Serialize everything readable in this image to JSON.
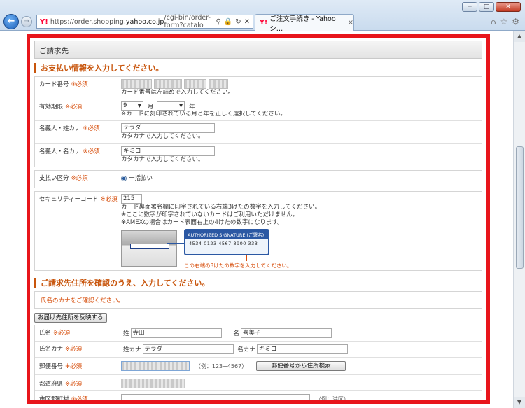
{
  "browser": {
    "url_prefix": "https://order.shopping.",
    "url_domain": "yahoo.co.jp",
    "url_suffix": "/cgi-bin/order-form?catalo",
    "tab_title": "ご注文手続き - Yahoo!シ…",
    "tab_close": "×",
    "back_icon": "back-arrow-icon",
    "forward_icon": "forward-arrow-icon",
    "win_minimize": "─",
    "win_maximize": "□",
    "win_close": "✕"
  },
  "page": {
    "header": "ご請求先",
    "payment_section": "お支払い情報を入力してください。",
    "required": "※必須",
    "card_number": {
      "label": "カード番号",
      "note": "カード番号は左詰めで入力してください。"
    },
    "expiry": {
      "label": "有効期限",
      "month_value": "9",
      "month_unit": "月",
      "year_unit": "年",
      "note": "※カードに刻印されている月と年を正しく選択してください。"
    },
    "holder_last": {
      "label": "名義人・姓カナ",
      "value": "テラダ",
      "note": "カタカナで入力してください。"
    },
    "holder_first": {
      "label": "名義人・名カナ",
      "value": "キミコ",
      "note": "カタカナで入力してください。"
    },
    "payment_type": {
      "label": "支払い区分",
      "option": "一括払い"
    },
    "security": {
      "label": "セキュリティーコード",
      "value": "215",
      "note1": "カード裏面署名欄に印字されている右端3けたの数字を入力してください。",
      "note2": "※ここに数字が印字されていないカードはご利用いただけません。",
      "note3": "※AMEXの場合はカード表面右上の4けたの数字になります。",
      "sig_caption": "AUTHORIZED SIGNATURE (ご署名)",
      "sig_number": "4534 0123 4567 8900 333",
      "img_note": "この右端の3けたの数字を入力してください。"
    },
    "address_section": "ご請求先住所を確認のうえ、入力してください。",
    "kana_notice": "氏名のカナをご確認ください。",
    "copy_button": "お届け先住所を反映する",
    "name": {
      "label": "氏名",
      "last_prefix": "姓",
      "last_value": "寺田",
      "first_prefix": "名",
      "first_value": "喜美子"
    },
    "name_kana": {
      "label": "氏名カナ",
      "last_prefix": "姓カナ",
      "last_value": "テラダ",
      "first_prefix": "名カナ",
      "first_value": "キミコ"
    },
    "postal": {
      "label": "郵便番号",
      "hint": "（例：123−4567）",
      "button": "郵便番号から住所検索"
    },
    "prefecture": {
      "label": "都道府県"
    },
    "city": {
      "label": "市区郡町村",
      "hint": "（例：港区）"
    }
  }
}
